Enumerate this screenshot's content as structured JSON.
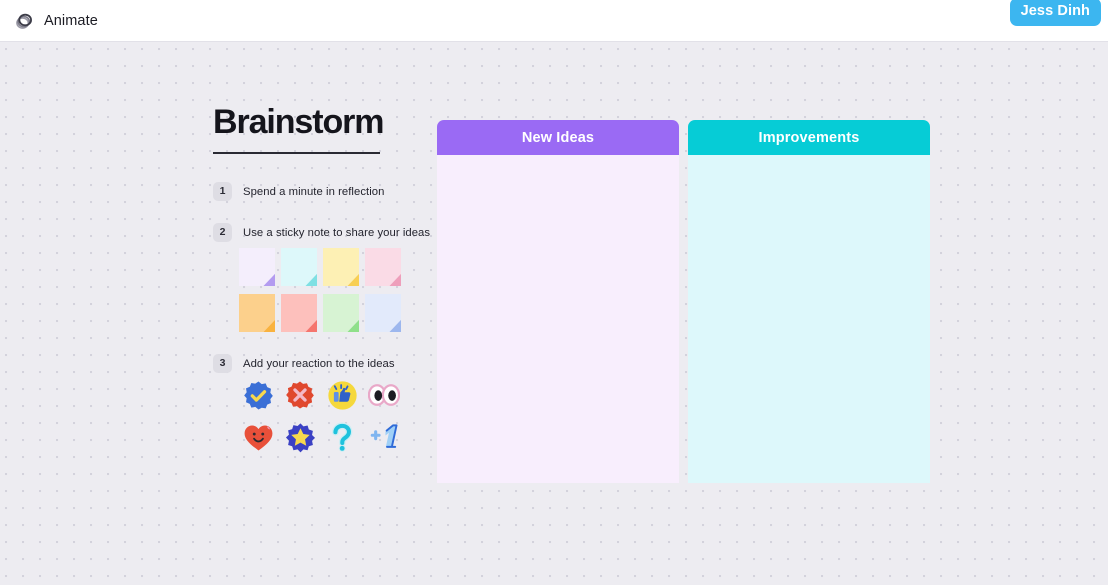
{
  "topbar": {
    "logo_icon": "stacked-rings-logo-icon",
    "brand_name": "Animate",
    "user_name": "Jess Dinh",
    "user_badge_color": "#3cb6f0"
  },
  "instructions": {
    "title": "Brainstorm",
    "steps": [
      {
        "number": "1",
        "label": "Spend a minute in reflection"
      },
      {
        "number": "2",
        "label": "Use a sticky note to share your ideas"
      },
      {
        "number": "3",
        "label": "Add your reaction to the ideas"
      }
    ]
  },
  "sticky_notes": [
    {
      "name": "sticky-note-lavender",
      "color": "#f4eefc",
      "fold": "#b39bf0"
    },
    {
      "name": "sticky-note-cyan",
      "color": "#ddf8fa",
      "fold": "#7fe0e3"
    },
    {
      "name": "sticky-note-yellow",
      "color": "#fdf0b4",
      "fold": "#f8cf54"
    },
    {
      "name": "sticky-note-pink",
      "color": "#fadbe6",
      "fold": "#ee9fbb"
    },
    {
      "name": "sticky-note-orange",
      "color": "#fcd08c",
      "fold": "#f9b23f"
    },
    {
      "name": "sticky-note-salmon",
      "color": "#fdc0bc",
      "fold": "#f5756e"
    },
    {
      "name": "sticky-note-green",
      "color": "#d7f3d3",
      "fold": "#8fe08a"
    },
    {
      "name": "sticky-note-blue",
      "color": "#e2eafb",
      "fold": "#9db7ee"
    }
  ],
  "reactions": [
    {
      "name": "check-badge-reaction",
      "label": "Approve"
    },
    {
      "name": "x-badge-reaction",
      "label": "Reject"
    },
    {
      "name": "thumbs-up-reaction",
      "label": "Thumbs up"
    },
    {
      "name": "eyes-reaction",
      "label": "Eyes"
    },
    {
      "name": "heart-smile-reaction",
      "label": "Love"
    },
    {
      "name": "star-badge-reaction",
      "label": "Star"
    },
    {
      "name": "question-mark-reaction",
      "label": "Question"
    },
    {
      "name": "plus-one-reaction",
      "label": "Plus one"
    }
  ],
  "columns": [
    {
      "title": "New Ideas",
      "header_color": "#9a6af4",
      "body_color": "#f8eefd",
      "cards": []
    },
    {
      "title": "Improvements",
      "header_color": "#06ccd6",
      "body_color": "#ddf8fb",
      "cards": []
    }
  ]
}
